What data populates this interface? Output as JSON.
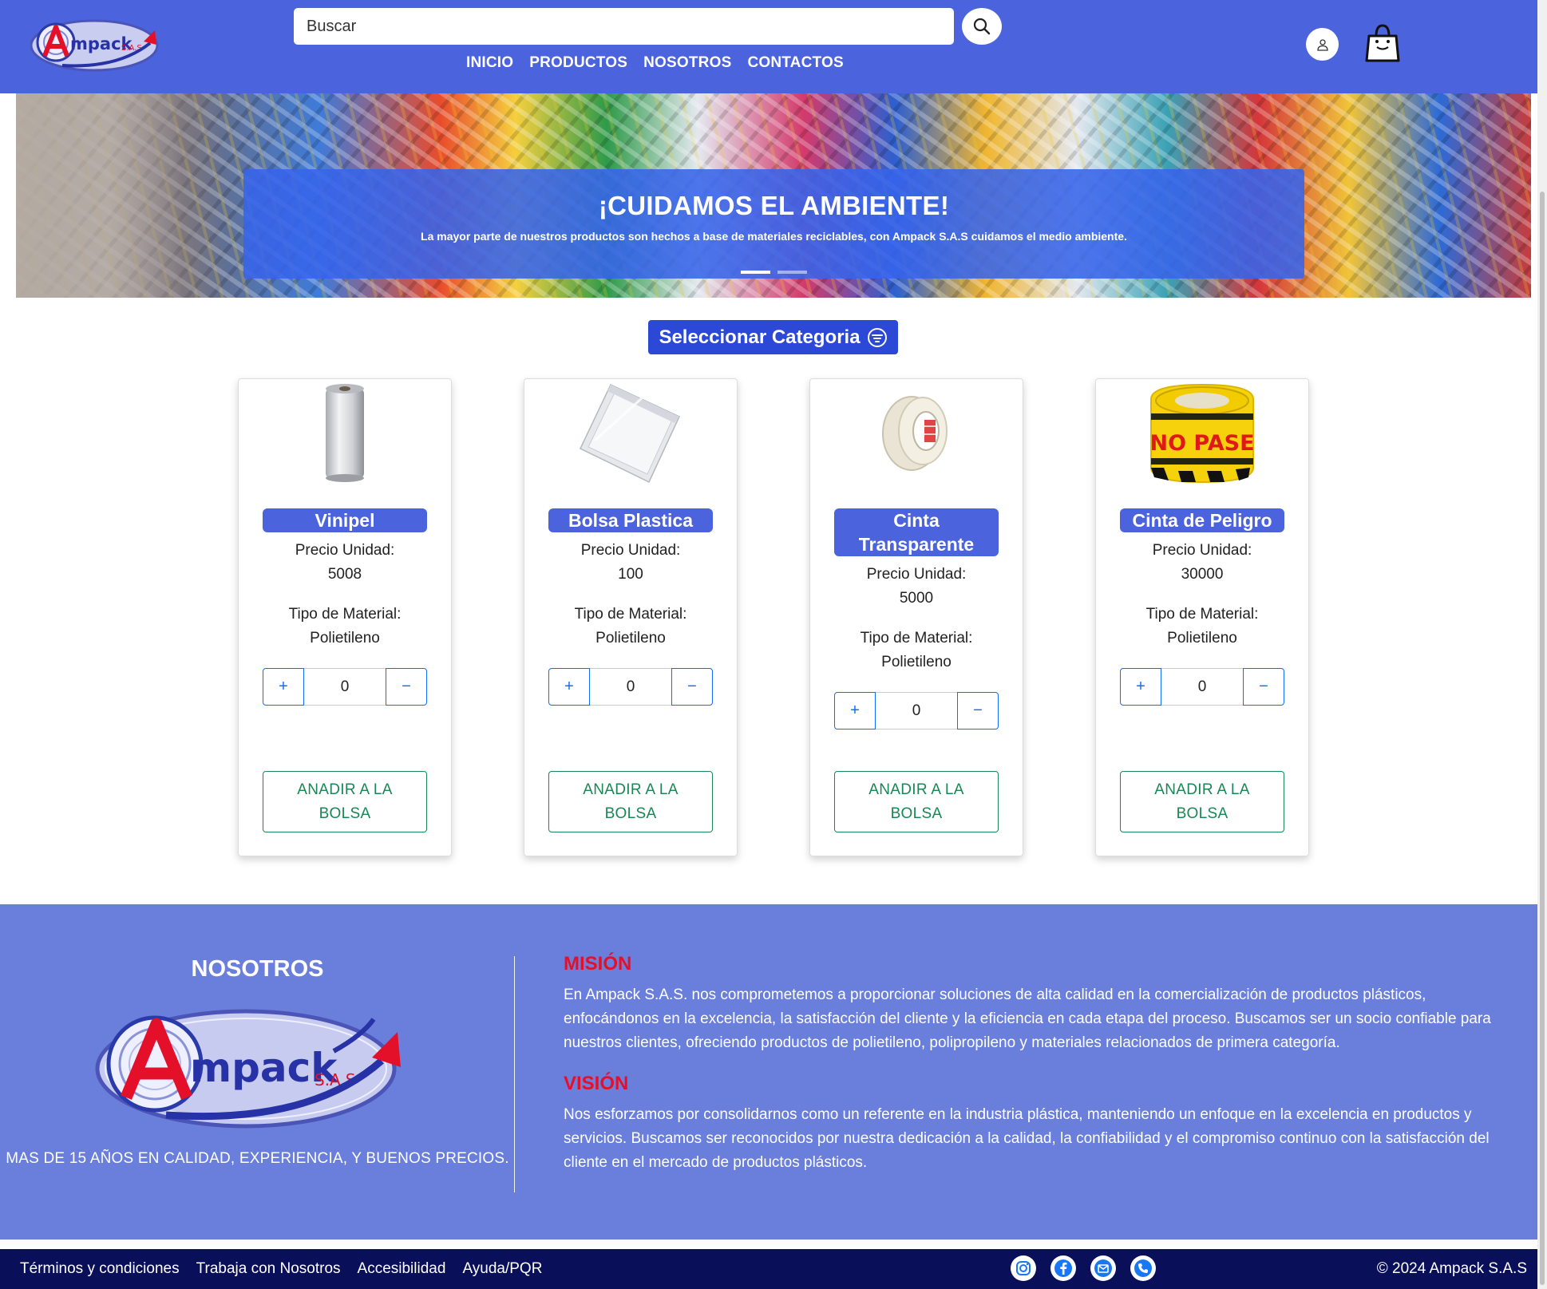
{
  "header": {
    "search_placeholder": "Buscar",
    "nav": [
      "INICIO",
      "PRODUCTOS",
      "NOSOTROS",
      "CONTACTOS"
    ]
  },
  "hero": {
    "title": "¡CUIDAMOS EL AMBIENTE!",
    "text": "La mayor parte de nuestros productos son hechos a base de materiales reciclables, con Ampack S.A.S cuidamos el medio ambiente.",
    "slides": 2,
    "active_slide": 1
  },
  "category_button": "Seleccionar Categoria",
  "products": [
    {
      "name": "Vinipel",
      "price_label": "Precio Unidad:",
      "price": "5008",
      "material_label": "Tipo de Material:",
      "material": "Polietileno",
      "qty": "0",
      "add_label": "ANADIR A LA BOLSA",
      "image": "film-roll"
    },
    {
      "name": "Bolsa Plastica",
      "price_label": "Precio Unidad:",
      "price": "100",
      "material_label": "Tipo de Material:",
      "material": "Polietileno",
      "qty": "0",
      "add_label": "ANADIR A LA BOLSA",
      "image": "plastic-bag"
    },
    {
      "name": "Cinta Transparente",
      "price_label": "Precio Unidad:",
      "price": "5000",
      "material_label": "Tipo de Material:",
      "material": "Polietileno",
      "qty": "0",
      "add_label": "ANADIR A LA BOLSA",
      "image": "tape-roll"
    },
    {
      "name": "Cinta de Peligro",
      "price_label": "Precio Unidad:",
      "price": "30000",
      "material_label": "Tipo de Material:",
      "material": "Polietileno",
      "qty": "0",
      "add_label": "ANADIR A LA BOLSA",
      "image": "danger-tape",
      "image_text": "NO PASE"
    }
  ],
  "footer_info": {
    "title": "NOSOTROS",
    "slogan": "MAS DE 15 AÑOS EN CALIDAD, EXPERIENCIA, Y BUENOS PRECIOS.",
    "mision_title": "MISIÓN",
    "mision_text": "En Ampack S.A.S. nos comprometemos a proporcionar soluciones de alta calidad en la comercialización de productos plásticos, enfocándonos en la excelencia, la satisfacción del cliente y la eficiencia en cada etapa del proceso. Buscamos ser un socio confiable para nuestros clientes, ofreciendo productos de polietileno, polipropileno y materiales relacionados de primera categoría.",
    "vision_title": "VISIÓN",
    "vision_text": "Nos esforzamos por consolidarnos como un referente en la industria plástica, manteniendo un enfoque en la excelencia en productos y servicios. Buscamos ser reconocidos por nuestra dedicación a la calidad, la confiabilidad y el compromiso continuo con la satisfacción del cliente en el mercado de productos plásticos."
  },
  "bottom_bar": {
    "links": [
      "Términos y condiciones",
      "Trabaja con Nosotros",
      "Accesibilidad",
      "Ayuda/PQR"
    ],
    "social_icons": [
      "instagram-icon",
      "facebook-icon",
      "mail-icon",
      "phone-icon"
    ],
    "copyright": "© 2024 Ampack S.A.S"
  },
  "brand": {
    "logo_text": "Ampack",
    "logo_suffix": "S.A.S",
    "header_color": "#4b63dc",
    "footer_color": "#6a7fdc",
    "bottom_color": "#0a0f5a",
    "accent_red": "#e4102a",
    "add_button_color": "#198754"
  }
}
